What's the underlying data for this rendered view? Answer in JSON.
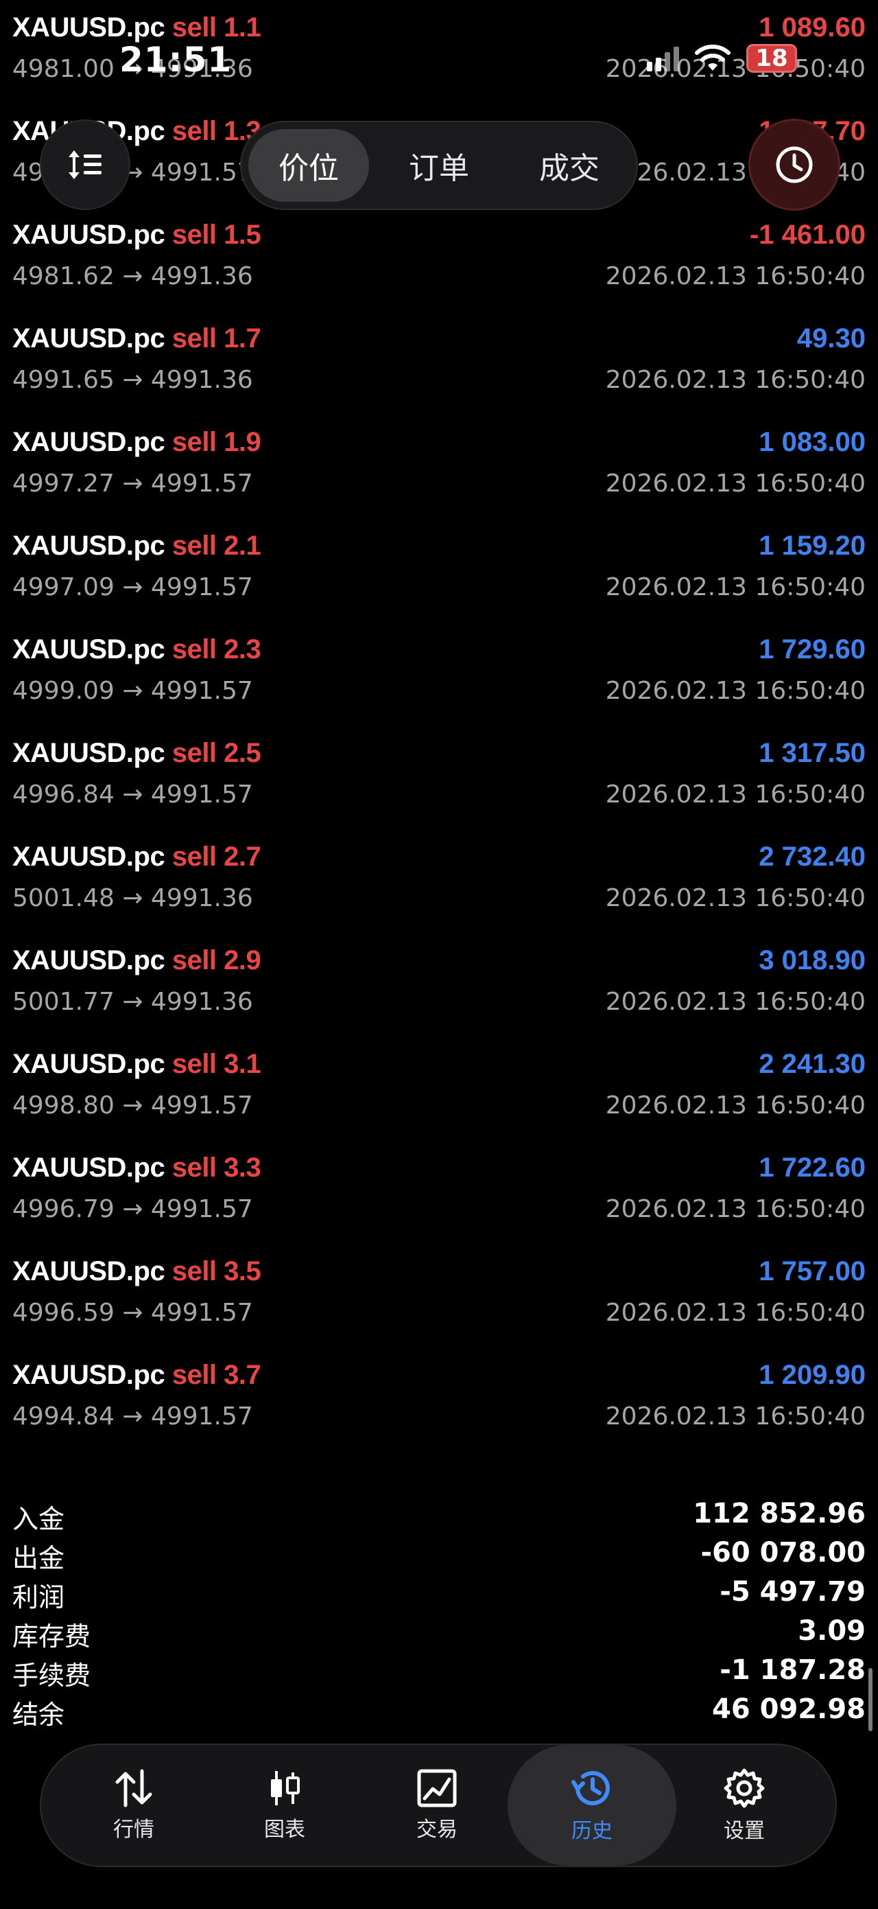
{
  "status_bar": {
    "time": "21:51",
    "battery": "18"
  },
  "segmented": {
    "items": [
      "价位",
      "订单",
      "成交"
    ],
    "active_index": 0
  },
  "history_rows": [
    {
      "symbol": "XAUUSD.pc",
      "side": "sell 1.1",
      "profit": "1 089.60",
      "profit_color": "neg",
      "prices": "4981.00 → 4991.36",
      "time": "2026.02.13 16:50:40"
    },
    {
      "symbol": "XAUUSD.pc",
      "side": "sell 1.3",
      "profit": "1 347.70",
      "profit_color": "neg",
      "prices": "4981.18 → 4991.57",
      "time": "2026.02.13 16:50:40"
    },
    {
      "symbol": "XAUUSD.pc",
      "side": "sell 1.5",
      "profit": "-1 461.00",
      "profit_color": "neg",
      "prices": "4981.62 → 4991.36",
      "time": "2026.02.13 16:50:40"
    },
    {
      "symbol": "XAUUSD.pc",
      "side": "sell 1.7",
      "profit": "49.30",
      "profit_color": "pos",
      "prices": "4991.65 → 4991.36",
      "time": "2026.02.13 16:50:40"
    },
    {
      "symbol": "XAUUSD.pc",
      "side": "sell 1.9",
      "profit": "1 083.00",
      "profit_color": "pos",
      "prices": "4997.27 → 4991.57",
      "time": "2026.02.13 16:50:40"
    },
    {
      "symbol": "XAUUSD.pc",
      "side": "sell 2.1",
      "profit": "1 159.20",
      "profit_color": "pos",
      "prices": "4997.09 → 4991.57",
      "time": "2026.02.13 16:50:40"
    },
    {
      "symbol": "XAUUSD.pc",
      "side": "sell 2.3",
      "profit": "1 729.60",
      "profit_color": "pos",
      "prices": "4999.09 → 4991.57",
      "time": "2026.02.13 16:50:40"
    },
    {
      "symbol": "XAUUSD.pc",
      "side": "sell 2.5",
      "profit": "1 317.50",
      "profit_color": "pos",
      "prices": "4996.84 → 4991.57",
      "time": "2026.02.13 16:50:40"
    },
    {
      "symbol": "XAUUSD.pc",
      "side": "sell 2.7",
      "profit": "2 732.40",
      "profit_color": "pos",
      "prices": "5001.48 → 4991.36",
      "time": "2026.02.13 16:50:40"
    },
    {
      "symbol": "XAUUSD.pc",
      "side": "sell 2.9",
      "profit": "3 018.90",
      "profit_color": "pos",
      "prices": "5001.77 → 4991.36",
      "time": "2026.02.13 16:50:40"
    },
    {
      "symbol": "XAUUSD.pc",
      "side": "sell 3.1",
      "profit": "2 241.30",
      "profit_color": "pos",
      "prices": "4998.80 → 4991.57",
      "time": "2026.02.13 16:50:40"
    },
    {
      "symbol": "XAUUSD.pc",
      "side": "sell 3.3",
      "profit": "1 722.60",
      "profit_color": "pos",
      "prices": "4996.79 → 4991.57",
      "time": "2026.02.13 16:50:40"
    },
    {
      "symbol": "XAUUSD.pc",
      "side": "sell 3.5",
      "profit": "1 757.00",
      "profit_color": "pos",
      "prices": "4996.59 → 4991.57",
      "time": "2026.02.13 16:50:40"
    },
    {
      "symbol": "XAUUSD.pc",
      "side": "sell 3.7",
      "profit": "1 209.90",
      "profit_color": "pos",
      "prices": "4994.84 → 4991.57",
      "time": "2026.02.13 16:50:40"
    }
  ],
  "summary": [
    {
      "label": "入金",
      "value": "112 852.96"
    },
    {
      "label": "出金",
      "value": "-60 078.00"
    },
    {
      "label": "利润",
      "value": "-5 497.79"
    },
    {
      "label": "库存费",
      "value": "3.09"
    },
    {
      "label": "手续费",
      "value": "-1 187.28"
    },
    {
      "label": "结余",
      "value": "46 092.98"
    }
  ],
  "tabbar": {
    "items": [
      {
        "label": "行情",
        "icon": "arrows-updown-icon"
      },
      {
        "label": "图表",
        "icon": "candlestick-icon"
      },
      {
        "label": "交易",
        "icon": "trade-chart-icon"
      },
      {
        "label": "历史",
        "icon": "history-clock-icon"
      },
      {
        "label": "设置",
        "icon": "gear-icon"
      }
    ],
    "active_index": 3
  },
  "colors": {
    "positive": "#3f82ef",
    "negative": "#e84545",
    "active_tab": "#3f8bff",
    "background": "#000000"
  }
}
